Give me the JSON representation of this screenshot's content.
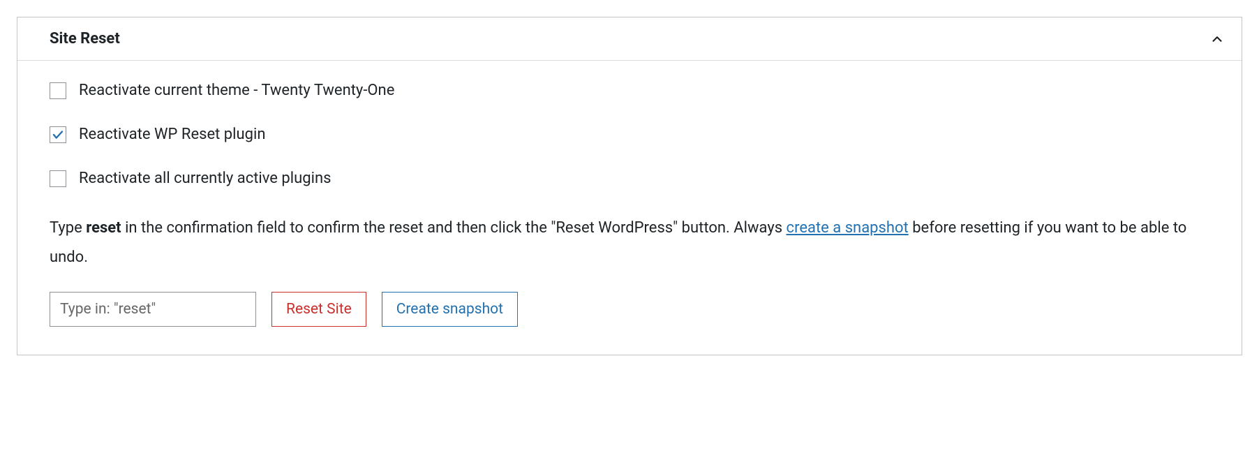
{
  "panel": {
    "title": "Site Reset",
    "expanded": true
  },
  "options": [
    {
      "label": "Reactivate current theme - Twenty Twenty-One",
      "checked": false
    },
    {
      "label": "Reactivate WP Reset plugin",
      "checked": true
    },
    {
      "label": "Reactivate all currently active plugins",
      "checked": false
    }
  ],
  "instructions": {
    "pre": "Type ",
    "keyword": "reset",
    "mid": " in the confirmation field to confirm the reset and then click the \"Reset WordPress\" button. Always ",
    "link": "create a snapshot",
    "post": " before resetting if you want to be able to undo."
  },
  "confirm": {
    "placeholder": "Type in: \"reset\"",
    "value": ""
  },
  "buttons": {
    "reset": "Reset Site",
    "snapshot": "Create snapshot"
  }
}
